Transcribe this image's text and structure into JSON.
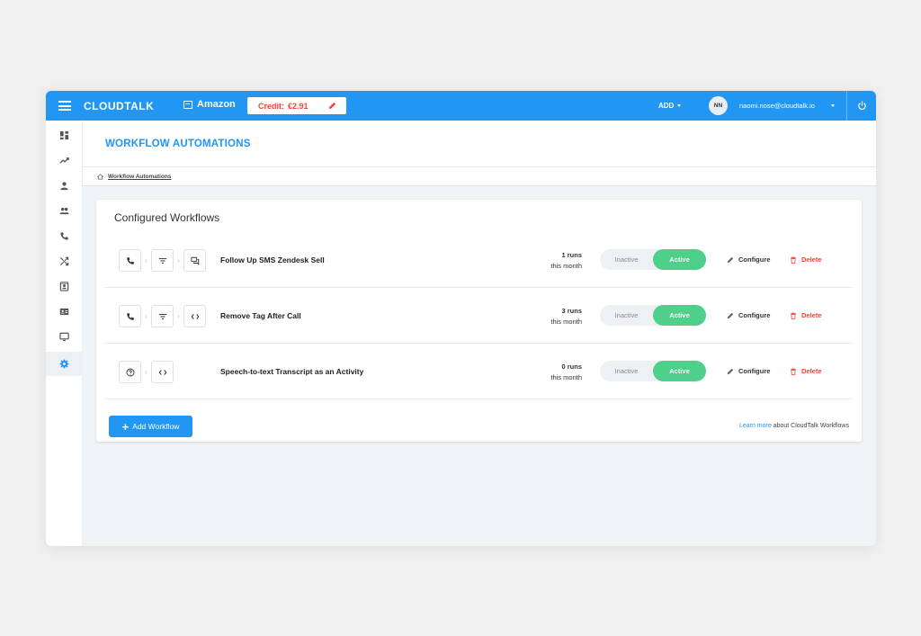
{
  "topbar": {
    "logo": "CLOUDTALK",
    "company": "Amazon",
    "credit_label": "Credit:",
    "credit_value": "€2.91",
    "add_label": "ADD",
    "avatar_initials": "NN",
    "user_email": "naomi.nose@cloudtalk.io"
  },
  "sidebar": {
    "items": [
      {
        "icon": "dashboard-icon"
      },
      {
        "icon": "analytics-icon"
      },
      {
        "icon": "user-icon"
      },
      {
        "icon": "group-icon"
      },
      {
        "icon": "phone-icon"
      },
      {
        "icon": "shuffle-icon"
      },
      {
        "icon": "contacts-icon"
      },
      {
        "icon": "id-card-icon"
      },
      {
        "icon": "monitor-icon"
      },
      {
        "icon": "settings-icon",
        "active": true
      }
    ]
  },
  "page": {
    "title": "WORKFLOW AUTOMATIONS",
    "breadcrumb": "Workflow Automations"
  },
  "card": {
    "title": "Configured Workflows",
    "workflows": [
      {
        "name": "Follow Up SMS Zendesk Sell",
        "runs": "1 runs",
        "period": "this month",
        "steps": [
          "phone-icon",
          "filter-icon",
          "sms-icon"
        ]
      },
      {
        "name": "Remove Tag After Call",
        "runs": "3 runs",
        "period": "this month",
        "steps": [
          "phone-icon",
          "filter-icon",
          "code-icon"
        ]
      },
      {
        "name": "Speech-to-text Transcript as an Activity",
        "runs": "0 runs",
        "period": "this month",
        "steps": [
          "help-icon",
          "code-icon"
        ]
      }
    ],
    "toggle_inactive": "Inactive",
    "toggle_active": "Active",
    "configure_label": "Configure",
    "delete_label": "Delete",
    "add_workflow_label": "Add Workflow",
    "learn_more_link": "Learn more",
    "learn_more_text": " about CloudTalk Workflows"
  },
  "colors": {
    "primary": "#2196f3",
    "active_green": "#4fd08a",
    "danger": "#f44336"
  }
}
